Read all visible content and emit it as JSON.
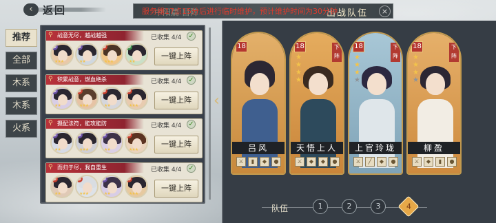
{
  "header": {
    "back_label": "返回",
    "back_icon": "‹",
    "title_ghost": "中阳篇 目阵",
    "title": "出战队伍",
    "close_icon": "×",
    "marquee": "服务器17点15分后进行临时维护，预计维护时间为30分钟"
  },
  "tabs": [
    {
      "label": "推荐",
      "active": true
    },
    {
      "label": "全部",
      "active": false
    },
    {
      "label": "木系",
      "active": false
    },
    {
      "label": "木系",
      "active": false
    },
    {
      "label": "火系",
      "active": false
    }
  ],
  "lineups": [
    {
      "title": "战意无尽，越战越强",
      "collected": "已收集 4/4",
      "button": "一键上阵"
    },
    {
      "title": "积累战意，燃血绝杀",
      "collected": "已收集 4/4",
      "button": "一键上阵"
    },
    {
      "title": "摄配法符，能攻能防",
      "collected": "已收集 4/4",
      "button": "一键上阵"
    },
    {
      "title": "而归于尽，我自重生",
      "collected": "已收集 4/4",
      "button": "一键上阵"
    }
  ],
  "heroes": [
    {
      "name": "吕风",
      "level": "18",
      "stars": 0,
      "removable": false,
      "bg": "#d69a4b"
    },
    {
      "name": "天悟上人",
      "level": "18",
      "stars": 4,
      "removable": true,
      "bg": "#d7913f"
    },
    {
      "name": "上官玲珑",
      "level": "18",
      "stars": 3,
      "removable": true,
      "bg": "#8fb2c4"
    },
    {
      "name": "柳盈",
      "level": "18",
      "stars": 3,
      "removable": true,
      "bg": "#d99545"
    }
  ],
  "remove_label": "下阵",
  "team_bar": {
    "label": "队伍",
    "numbers": [
      "1",
      "2",
      "3",
      "4"
    ],
    "active_index": 3
  }
}
